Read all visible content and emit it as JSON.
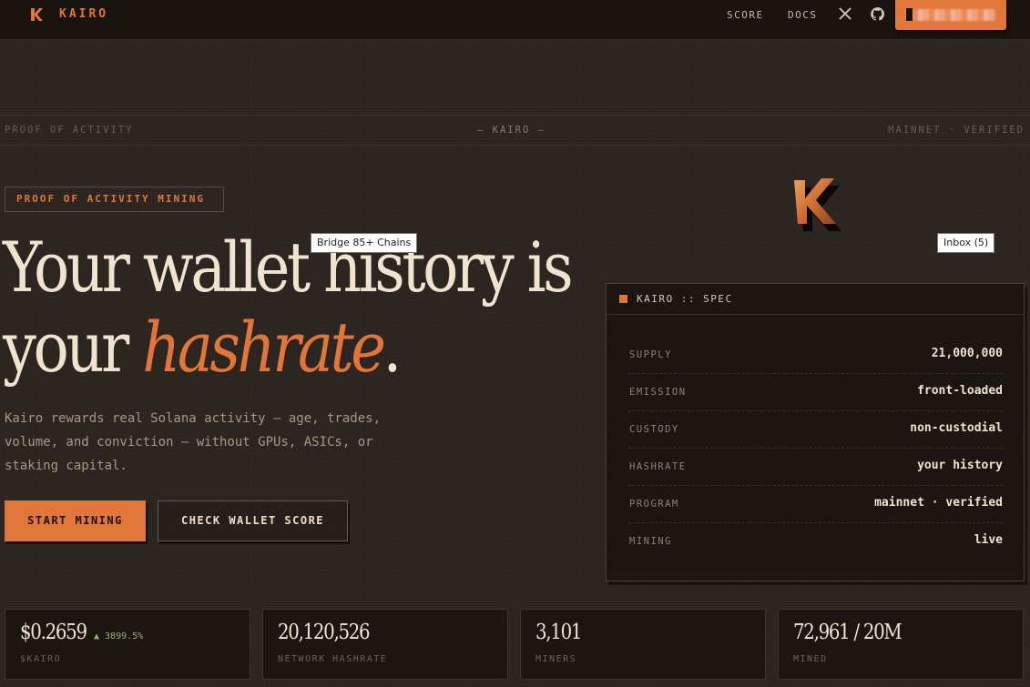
{
  "nav": {
    "brand": "KAIRO",
    "links": [
      {
        "label": "SCORE"
      },
      {
        "label": "DOCS"
      }
    ],
    "icons": [
      "x-icon",
      "github-icon"
    ],
    "accent_color": "#e2763a"
  },
  "band": {
    "left": "PROOF OF ACTIVITY",
    "center": "— KAIRO —",
    "right": "MAINNET · VERIFIED"
  },
  "hero": {
    "tag": "PROOF OF ACTIVITY MINING",
    "headline_line1": "Your wallet history is",
    "headline_line2_start": "your ",
    "headline_accent": "hashrate",
    "headline_end": ".",
    "lead": "Kairo rewards real Solana activity — age, trades, volume, and conviction — without GPUs, ASICs, or staking capital.",
    "primary_button": "START MINING",
    "secondary_button": "CHECK WALLET SCORE"
  },
  "tooltips": {
    "bridge": "Bridge 85+ Chains",
    "inbox": "Inbox (5)"
  },
  "spec": {
    "title": "KAIRO :: SPEC",
    "rows": [
      {
        "key": "SUPPLY",
        "value": "21,000,000"
      },
      {
        "key": "EMISSION",
        "value": "front-loaded"
      },
      {
        "key": "CUSTODY",
        "value": "non-custodial"
      },
      {
        "key": "HASHRATE",
        "value": "your history"
      },
      {
        "key": "PROGRAM",
        "value": "mainnet · verified"
      },
      {
        "key": "MINING",
        "value": "live"
      }
    ]
  },
  "stats": [
    {
      "value": "$0.2659",
      "delta": "▲ 3899.5%",
      "label": "$KAIRO"
    },
    {
      "value": "20,120,526",
      "label": "NETWORK HASHRATE"
    },
    {
      "value": "3,101",
      "label": "MINERS"
    },
    {
      "value": "72,961 / 20M",
      "label": "MINED"
    }
  ]
}
